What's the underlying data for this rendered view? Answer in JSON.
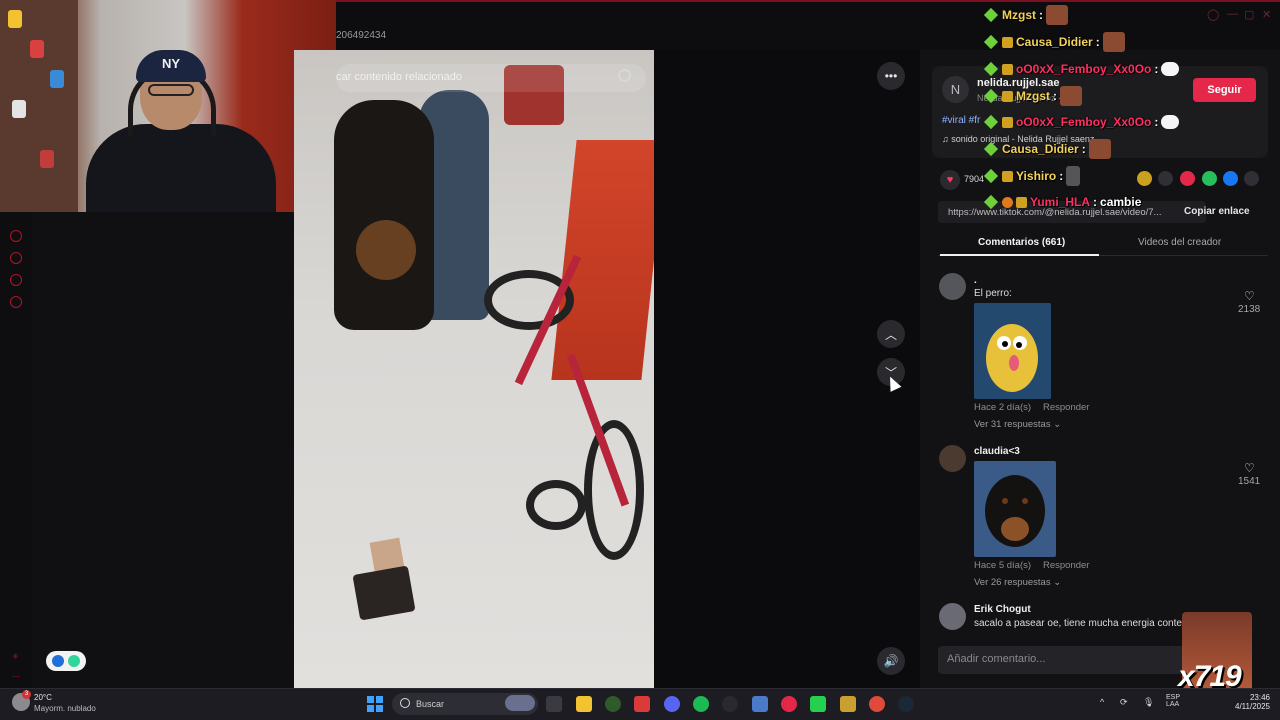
{
  "browser": {
    "url_fragment": "206492434"
  },
  "video": {
    "search_placeholder": "car contenido relacionado"
  },
  "author": {
    "avatar_letter": "N",
    "name": "nelida.rujjel.sae",
    "sub": "Nelida Rujjel Saenz · 21",
    "follow_label": "Seguir",
    "hashtags": "#viral #fr",
    "sound": "sonido original - Nelida Rujjel saenz",
    "likes": "7904",
    "link": "https://www.tiktok.com/@nelida.rujjel.sae/video/7...",
    "copy_link_label": "Copiar enlace"
  },
  "tabs": [
    {
      "label": "Comentarios (661)",
      "active": true
    },
    {
      "label": "Videos del creador",
      "active": false
    }
  ],
  "comments": [
    {
      "user": ".",
      "text": "El perro:",
      "meta": "Hace 2 día(s)",
      "reply": "Responder",
      "more": "Ver 31 respuestas",
      "likes": "2138",
      "image": "dragon-meme"
    },
    {
      "user": "claudia<3",
      "text": "",
      "meta": "Hace 5 día(s)",
      "reply": "Responder",
      "more": "Ver 26 respuestas",
      "likes": "1541",
      "image": "rottweiler-photo"
    },
    {
      "user": "Erik Chogut",
      "text": "sacalo a pasear oe, tiene mucha energia contenie",
      "meta": "",
      "reply": "",
      "more": "",
      "likes": ""
    }
  ],
  "comment_input": {
    "placeholder": "Añadir comentario..."
  },
  "chat": [
    {
      "user": "Mzgst",
      "color": "#f2d25a",
      "msg": "",
      "emote": "face"
    },
    {
      "user": "Causa_Didier",
      "color": "#f2d25a",
      "msg": "",
      "emote": "face"
    },
    {
      "user": "oO0xX_Femboy_Xx0Oo",
      "color": "#ff2e63",
      "msg": "",
      "emote": "bubble"
    },
    {
      "user": "Mzgst",
      "color": "#f2d25a",
      "msg": "",
      "emote": "face"
    },
    {
      "user": "oO0xX_Femboy_Xx0Oo",
      "color": "#ff2e63",
      "msg": "",
      "emote": "bubble"
    },
    {
      "user": "Causa_Didier",
      "color": "#f2d25a",
      "msg": "",
      "emote": "face"
    },
    {
      "user": "Yishiro",
      "color": "#f2d25a",
      "msg": "",
      "emote": "figure"
    },
    {
      "user": "Yumi_HLA",
      "color": "#ff2e63",
      "msg": "cambie",
      "emote": ""
    }
  ],
  "overlay": {
    "multiplier": "x719"
  },
  "taskbar": {
    "weather_badge": "3",
    "temperature": "20°C",
    "weather_desc": "Mayorm. nublado",
    "search_label": "Buscar",
    "lang_top": "ESP",
    "lang_bottom": "LAA",
    "time": "23:46",
    "date": "4/11/2025"
  },
  "colors": {
    "accent": "#e5284a",
    "rail_icon": "#b0142a",
    "panel_bg": "#121214"
  }
}
